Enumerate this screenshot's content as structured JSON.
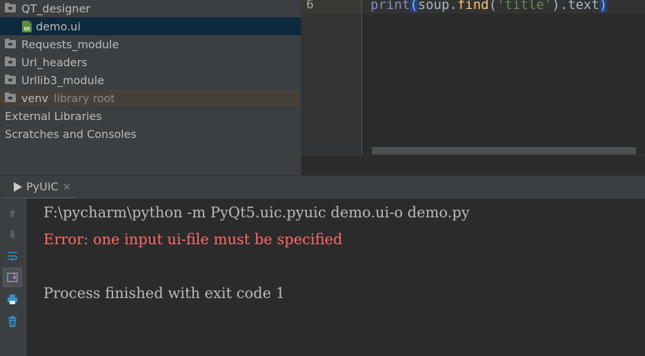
{
  "project_tree": {
    "items": [
      {
        "label": "QT_designer",
        "type": "folder",
        "suffix": ""
      },
      {
        "label": "demo.ui",
        "type": "qt-file",
        "suffix": "",
        "selected": true
      },
      {
        "label": "Requests_module",
        "type": "folder",
        "suffix": ""
      },
      {
        "label": "Url_headers",
        "type": "folder",
        "suffix": ""
      },
      {
        "label": "Urllib3_module",
        "type": "folder",
        "suffix": ""
      },
      {
        "label": "venv",
        "type": "folder",
        "suffix": "library root",
        "highlighted": true
      },
      {
        "label": "External Libraries",
        "type": "root",
        "suffix": ""
      },
      {
        "label": "Scratches and Consoles",
        "type": "root",
        "suffix": ""
      }
    ],
    "qt_icon_text": "Qt"
  },
  "editor": {
    "line_number": "6",
    "code": {
      "kw": "print",
      "open": "(",
      "obj": "soup.",
      "fn": "find",
      "fn_open": "(",
      "str": "'title'",
      "rest": ").text",
      "close": ")"
    }
  },
  "run_panel": {
    "tab_label": "PyUIC",
    "tab_close": "×",
    "toolbar_icons": [
      "arrow-up-icon",
      "arrow-down-icon",
      "soft-wrap-icon",
      "scroll-to-end-icon",
      "print-icon",
      "trash-icon"
    ],
    "console_lines": [
      {
        "text": "F:\\pycharm\\python -m PyQt5.uic.pyuic demo.ui-o demo.py",
        "kind": "normal"
      },
      {
        "text": "Error: one input ui-file must be specified",
        "kind": "error"
      },
      {
        "text": "",
        "kind": "normal"
      },
      {
        "text": "Process finished with exit code 1",
        "kind": "normal"
      }
    ]
  },
  "colors": {
    "panel_bg": "#3c3f41",
    "editor_bg": "#2b2b2b",
    "selected_row": "#0d293e",
    "highlight_row": "#45403a",
    "error_text": "#ff6b68"
  }
}
